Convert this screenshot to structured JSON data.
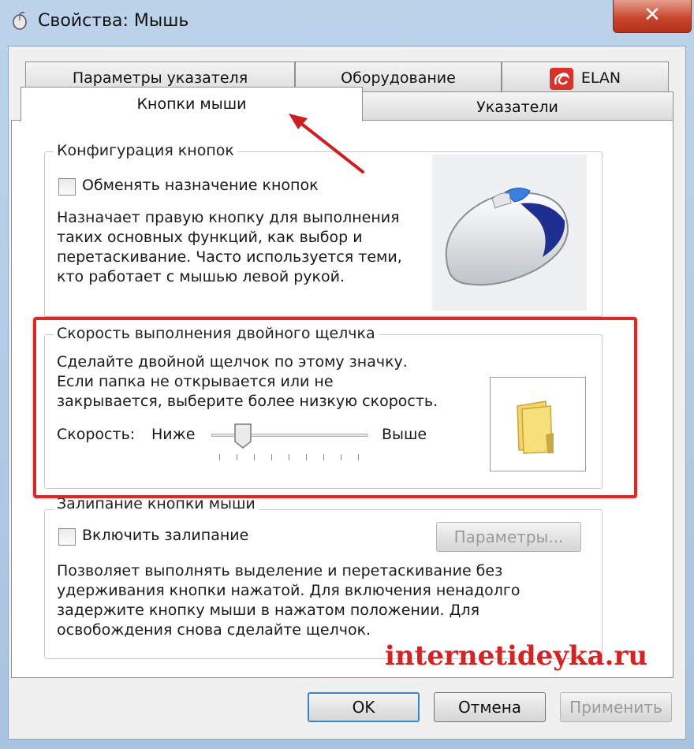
{
  "window": {
    "title": "Свойства: Мышь",
    "close_label": "✕"
  },
  "tabs": {
    "row_back": [
      {
        "label": "Параметры указателя"
      },
      {
        "label": "Оборудование"
      },
      {
        "label": "ELAN"
      }
    ],
    "row_front": [
      {
        "label": "Кнопки мыши",
        "active": true
      },
      {
        "label": "Указатели"
      }
    ]
  },
  "button_config": {
    "title": "Конфигурация кнопок",
    "swap_checkbox_label": "Обменять назначение кнопок",
    "swap_checked": false,
    "description": [
      "Назначает правую кнопку для выполнения",
      "таких основных функций, как выбор и",
      "перетаскивание. Часто используется теми,",
      "кто работает с мышью левой рукой."
    ]
  },
  "double_click": {
    "title": "Скорость выполнения двойного щелчка",
    "description": [
      "Сделайте двойной щелчок по этому значку.",
      "Если папка не открывается или не",
      "закрывается, выберите более низкую скорость."
    ],
    "speed_label": "Скорость:",
    "slow_label": "Ниже",
    "fast_label": "Выше",
    "slider_value": 0.2
  },
  "click_lock": {
    "title": "Залипание кнопки мыши",
    "enable_checkbox_label": "Включить залипание",
    "enable_checked": false,
    "settings_button": "Параметры...",
    "description": [
      "Позволяет выполнять выделение и перетаскивание без",
      "удерживания кнопки нажатой. Для включения ненадолго",
      "задержите кнопку мыши в нажатом положении. Для",
      "освобождения снова сделайте щелчок."
    ]
  },
  "footer": {
    "ok": "OK",
    "cancel": "Отмена",
    "apply": "Применить"
  },
  "watermark": "internetideyka.ru",
  "colors": {
    "highlight": "#d52b2b",
    "accent": "#3b85c4",
    "watermark": "#d42323"
  }
}
